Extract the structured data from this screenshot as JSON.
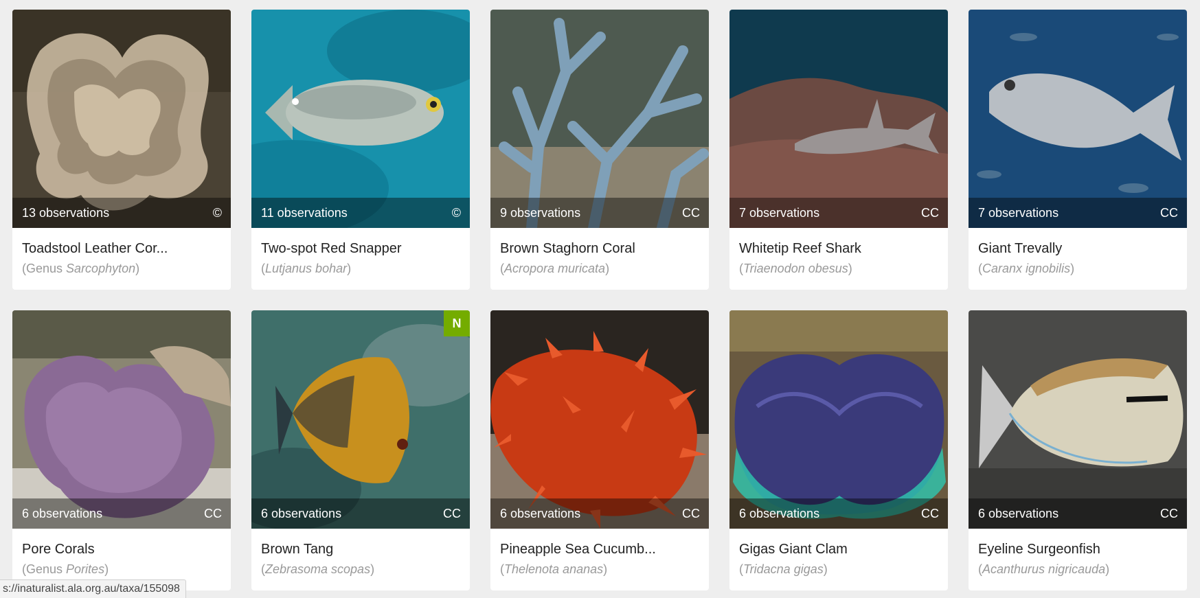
{
  "cards": [
    {
      "observations": "13 observations",
      "license": "©",
      "common_name": "Toadstool Leather Cor...",
      "sci_prefix": "Genus ",
      "sci_italic": "Sarcophyton",
      "badge": "",
      "palette": [
        "#5b4e3a",
        "#3d3526",
        "#c9b8a0"
      ]
    },
    {
      "observations": "11 observations",
      "license": "©",
      "common_name": "Two-spot Red Snapper",
      "sci_prefix": "",
      "sci_italic": "Lutjanus bohar",
      "badge": "",
      "palette": [
        "#1a8fa8",
        "#0d6f88",
        "#b8c8c0"
      ]
    },
    {
      "observations": "9 observations",
      "license": "CC",
      "common_name": "Brown Staghorn Coral",
      "sci_prefix": "",
      "sci_italic": "Acropora muricata",
      "badge": "",
      "palette": [
        "#5f6a5a",
        "#3b4a48",
        "#7fa0b8"
      ]
    },
    {
      "observations": "7 observations",
      "license": "CC",
      "common_name": "Whitetip Reef Shark",
      "sci_prefix": "",
      "sci_italic": "Triaenodon obesus",
      "badge": "",
      "palette": [
        "#0f3a4e",
        "#6b4a42",
        "#a5a0a0"
      ]
    },
    {
      "observations": "7 observations",
      "license": "CC",
      "common_name": "Giant Trevally",
      "sci_prefix": "",
      "sci_italic": "Caranx ignobilis",
      "badge": "",
      "palette": [
        "#1a4a78",
        "#163860",
        "#b8bec4"
      ]
    },
    {
      "observations": "6 observations",
      "license": "CC",
      "common_name": "Pore Corals",
      "sci_prefix": "Genus ",
      "sci_italic": "Porites",
      "badge": "",
      "palette": [
        "#7a7a6a",
        "#c9c6bd",
        "#8a6a95"
      ]
    },
    {
      "observations": "6 observations",
      "license": "CC",
      "common_name": "Brown Tang",
      "sci_prefix": "",
      "sci_italic": "Zebrasoma scopas",
      "badge": "N",
      "palette": [
        "#3f6f6a",
        "#2b4e50",
        "#c8901e"
      ]
    },
    {
      "observations": "6 observations",
      "license": "CC",
      "common_name": "Pineapple Sea Cucumb...",
      "sci_prefix": "",
      "sci_italic": "Thelenota ananas",
      "badge": "",
      "palette": [
        "#2a2520",
        "#8a7a6a",
        "#d84a1c"
      ]
    },
    {
      "observations": "6 observations",
      "license": "CC",
      "common_name": "Gigas Giant Clam",
      "sci_prefix": "",
      "sci_italic": "Tridacna gigas",
      "badge": "",
      "palette": [
        "#6a5a40",
        "#3a3a6a",
        "#2ec8b0"
      ]
    },
    {
      "observations": "6 observations",
      "license": "CC",
      "common_name": "Eyeline Surgeonfish",
      "sci_prefix": "",
      "sci_italic": "Acanthurus nigricauda",
      "badge": "",
      "palette": [
        "#5a5a58",
        "#3a3a38",
        "#d8d2bc"
      ]
    }
  ],
  "status_bar": {
    "url": "s://inaturalist.ala.org.au/taxa/155098"
  },
  "icons": {
    "overlay": "none"
  }
}
